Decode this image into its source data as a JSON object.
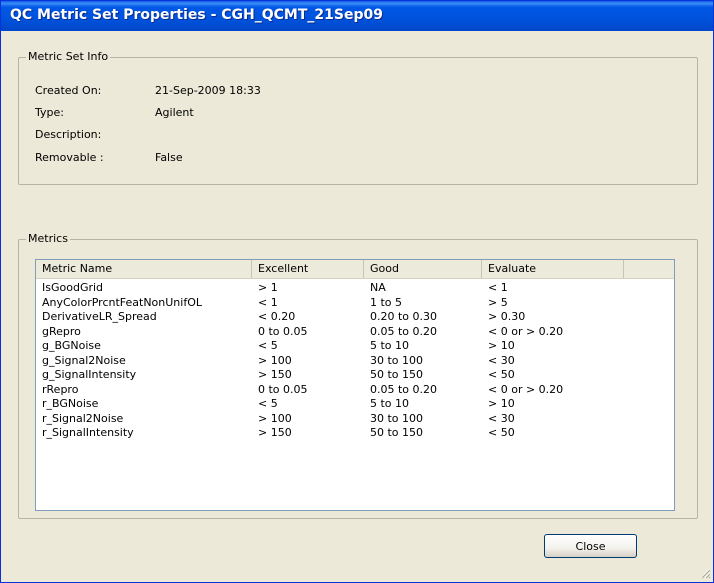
{
  "window": {
    "title": "QC Metric Set Properties - CGH_QCMT_21Sep09"
  },
  "metric_set_info": {
    "legend": "Metric Set Info",
    "fields": [
      {
        "label": "Created On:",
        "value": "21-Sep-2009 18:33"
      },
      {
        "label": "Type:",
        "value": "Agilent"
      },
      {
        "label": "Description:",
        "value": ""
      },
      {
        "label": "Removable :",
        "value": "False"
      }
    ]
  },
  "metrics": {
    "legend": "Metrics",
    "columns": [
      "Metric Name",
      "Excellent",
      "Good",
      "Evaluate"
    ],
    "rows": [
      [
        "IsGoodGrid",
        "> 1",
        "NA",
        "< 1"
      ],
      [
        "AnyColorPrcntFeatNonUnifOL",
        "< 1",
        "1 to 5",
        "> 5"
      ],
      [
        "DerivativeLR_Spread",
        "< 0.20",
        "0.20 to 0.30",
        "> 0.30"
      ],
      [
        "gRepro",
        "0 to 0.05",
        "0.05 to 0.20",
        "< 0 or > 0.20"
      ],
      [
        "g_BGNoise",
        "< 5",
        "5 to 10",
        "> 10"
      ],
      [
        "g_Signal2Noise",
        "> 100",
        "30 to 100",
        "< 30"
      ],
      [
        "g_SignalIntensity",
        "> 150",
        "50 to 150",
        "< 50"
      ],
      [
        "rRepro",
        "0 to 0.05",
        "0.05 to 0.20",
        "< 0 or > 0.20"
      ],
      [
        "r_BGNoise",
        "< 5",
        "5 to 10",
        "> 10"
      ],
      [
        "r_Signal2Noise",
        "> 100",
        "30 to 100",
        "< 30"
      ],
      [
        "r_SignalIntensity",
        "> 150",
        "50 to 150",
        "< 50"
      ]
    ]
  },
  "buttons": {
    "close": "Close"
  }
}
